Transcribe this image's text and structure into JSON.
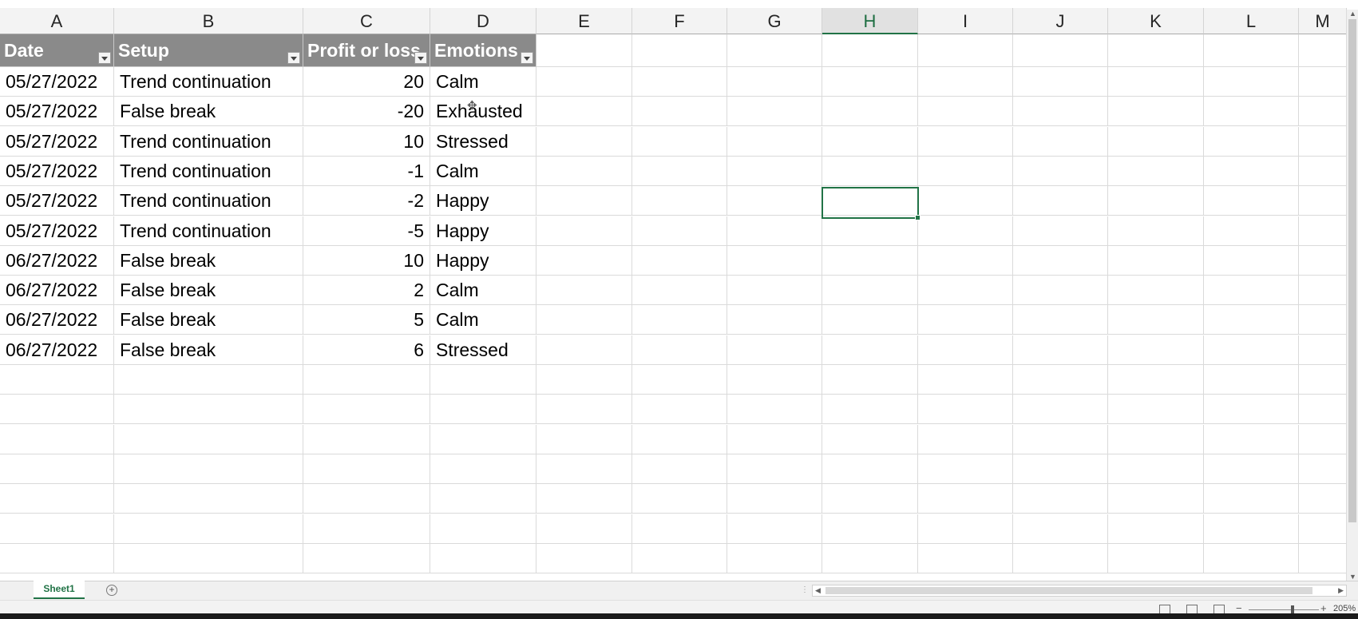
{
  "columns": [
    "A",
    "B",
    "C",
    "D",
    "E",
    "F",
    "G",
    "H",
    "I",
    "J",
    "K",
    "L",
    "M"
  ],
  "selected_column": "H",
  "table": {
    "headers": [
      "Date",
      "Setup",
      "Profit or loss",
      "Emotions"
    ],
    "rows": [
      [
        "05/27/2022",
        "Trend continuation",
        "20",
        "Calm"
      ],
      [
        "05/27/2022",
        "False break",
        "-20",
        "Exhausted"
      ],
      [
        "05/27/2022",
        "Trend continuation",
        "10",
        "Stressed"
      ],
      [
        "05/27/2022",
        "Trend continuation",
        "-1",
        "Calm"
      ],
      [
        "05/27/2022",
        "Trend continuation",
        "-2",
        "Happy"
      ],
      [
        "05/27/2022",
        "Trend continuation",
        "-5",
        "Happy"
      ],
      [
        "06/27/2022",
        "False break",
        "10",
        "Happy"
      ],
      [
        "06/27/2022",
        "False break",
        "2",
        "Calm"
      ],
      [
        "06/27/2022",
        "False break",
        "5",
        "Calm"
      ],
      [
        "06/27/2022",
        "False break",
        "6",
        "Stressed"
      ]
    ]
  },
  "sheet_tab": "Sheet1",
  "add_sheet_icon": "plus-circle-icon",
  "zoom_label": "205%",
  "colors": {
    "header_fill": "#8a8a8a",
    "accent": "#217346",
    "selected_header": "#e1e1e1"
  }
}
